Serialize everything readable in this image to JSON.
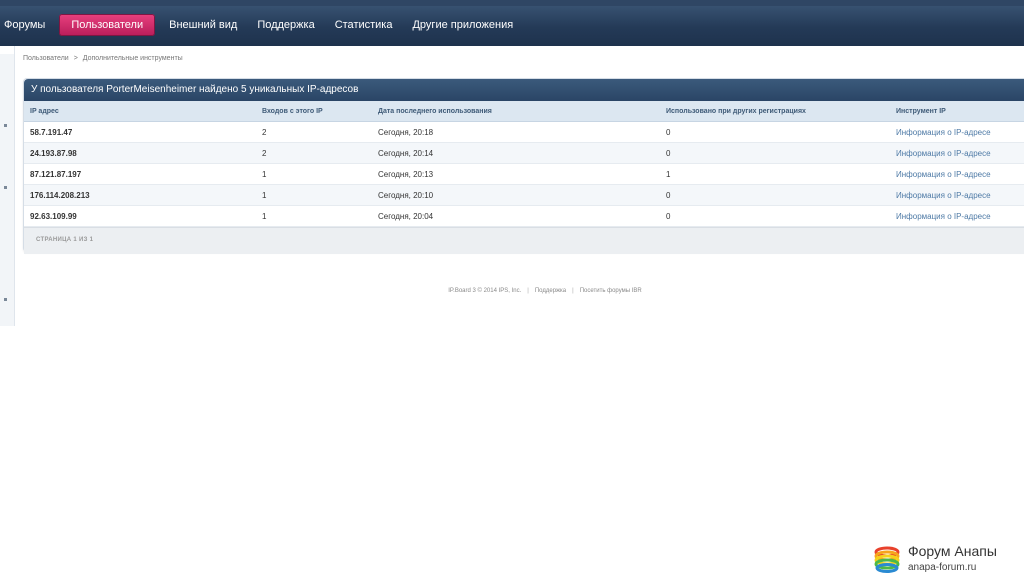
{
  "nav": {
    "items": [
      "Форумы",
      "Пользователи",
      "Внешний вид",
      "Поддержка",
      "Статистика",
      "Другие приложения"
    ]
  },
  "breadcrumb": {
    "root": "Пользователи",
    "separator": ">",
    "current": "Дополнительные инструменты"
  },
  "panel": {
    "title": "У пользователя PorterMeisenheimer найдено 5 уникальных IP-адресов",
    "columns": [
      "IP адрес",
      "Входов с этого IP",
      "Дата последнего использования",
      "Использовано при других регистрациях",
      "Инструмент IP"
    ],
    "rows": [
      {
        "ip": "58.7.191.47",
        "logins": "2",
        "last_used": "Сегодня, 20:18",
        "other_regs": "0",
        "tool": "Информация о IP-адресе"
      },
      {
        "ip": "24.193.87.98",
        "logins": "2",
        "last_used": "Сегодня, 20:14",
        "other_regs": "0",
        "tool": "Информация о IP-адресе"
      },
      {
        "ip": "87.121.87.197",
        "logins": "1",
        "last_used": "Сегодня, 20:13",
        "other_regs": "1",
        "tool": "Информация о IP-адресе"
      },
      {
        "ip": "176.114.208.213",
        "logins": "1",
        "last_used": "Сегодня, 20:10",
        "other_regs": "0",
        "tool": "Информация о IP-адресе"
      },
      {
        "ip": "92.63.109.99",
        "logins": "1",
        "last_used": "Сегодня, 20:04",
        "other_regs": "0",
        "tool": "Информация о IP-адресе"
      }
    ],
    "pager": "СТРАНИЦА 1 ИЗ 1"
  },
  "footer": {
    "copyright": "IP.Board 3 © 2014 IPS, Inc.",
    "separator": "|",
    "support": "Поддержка",
    "visit": "Посетить форумы IBR"
  },
  "watermark": {
    "title": "Форум Анапы",
    "url": "anapa-forum.ru",
    "logo_icon": "colorful-ring-logo-icon"
  },
  "colors": {
    "topbar": "#2a4566",
    "active_tab": "#d3306f",
    "panel_header": "#2f4b6d",
    "link": "#4e7aa6"
  }
}
